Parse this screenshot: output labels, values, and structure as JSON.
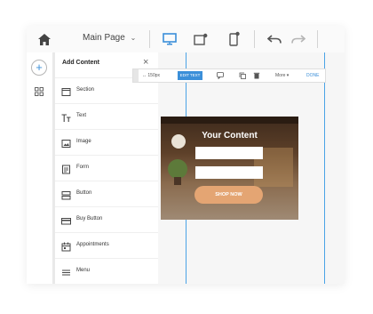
{
  "header": {
    "page_selector": {
      "label": "Main Page",
      "caret": "⌄"
    }
  },
  "sidebar": {
    "title": "Add Content",
    "close": "×",
    "items": [
      {
        "label": "Section",
        "icon": "section-icon"
      },
      {
        "label": "Text",
        "icon": "text-icon"
      },
      {
        "label": "Image",
        "icon": "image-icon"
      },
      {
        "label": "Form",
        "icon": "form-icon"
      },
      {
        "label": "Button",
        "icon": "button-icon"
      },
      {
        "label": "Buy Button",
        "icon": "buy-button-icon"
      },
      {
        "label": "Appointments",
        "icon": "calendar-icon"
      },
      {
        "label": "Menu",
        "icon": "menu-icon"
      }
    ]
  },
  "editor_toolbar": {
    "width_readout": "↔ 150px",
    "edit_text": "EDIT TEXT",
    "more": "More",
    "more_caret": "▾",
    "done": "DONE"
  },
  "hero": {
    "title": "Your Content",
    "button": "SHOP NOW"
  },
  "colors": {
    "accent": "#3b8fd9",
    "guide": "#4aa3e6",
    "shop_button": "#e4a573"
  }
}
